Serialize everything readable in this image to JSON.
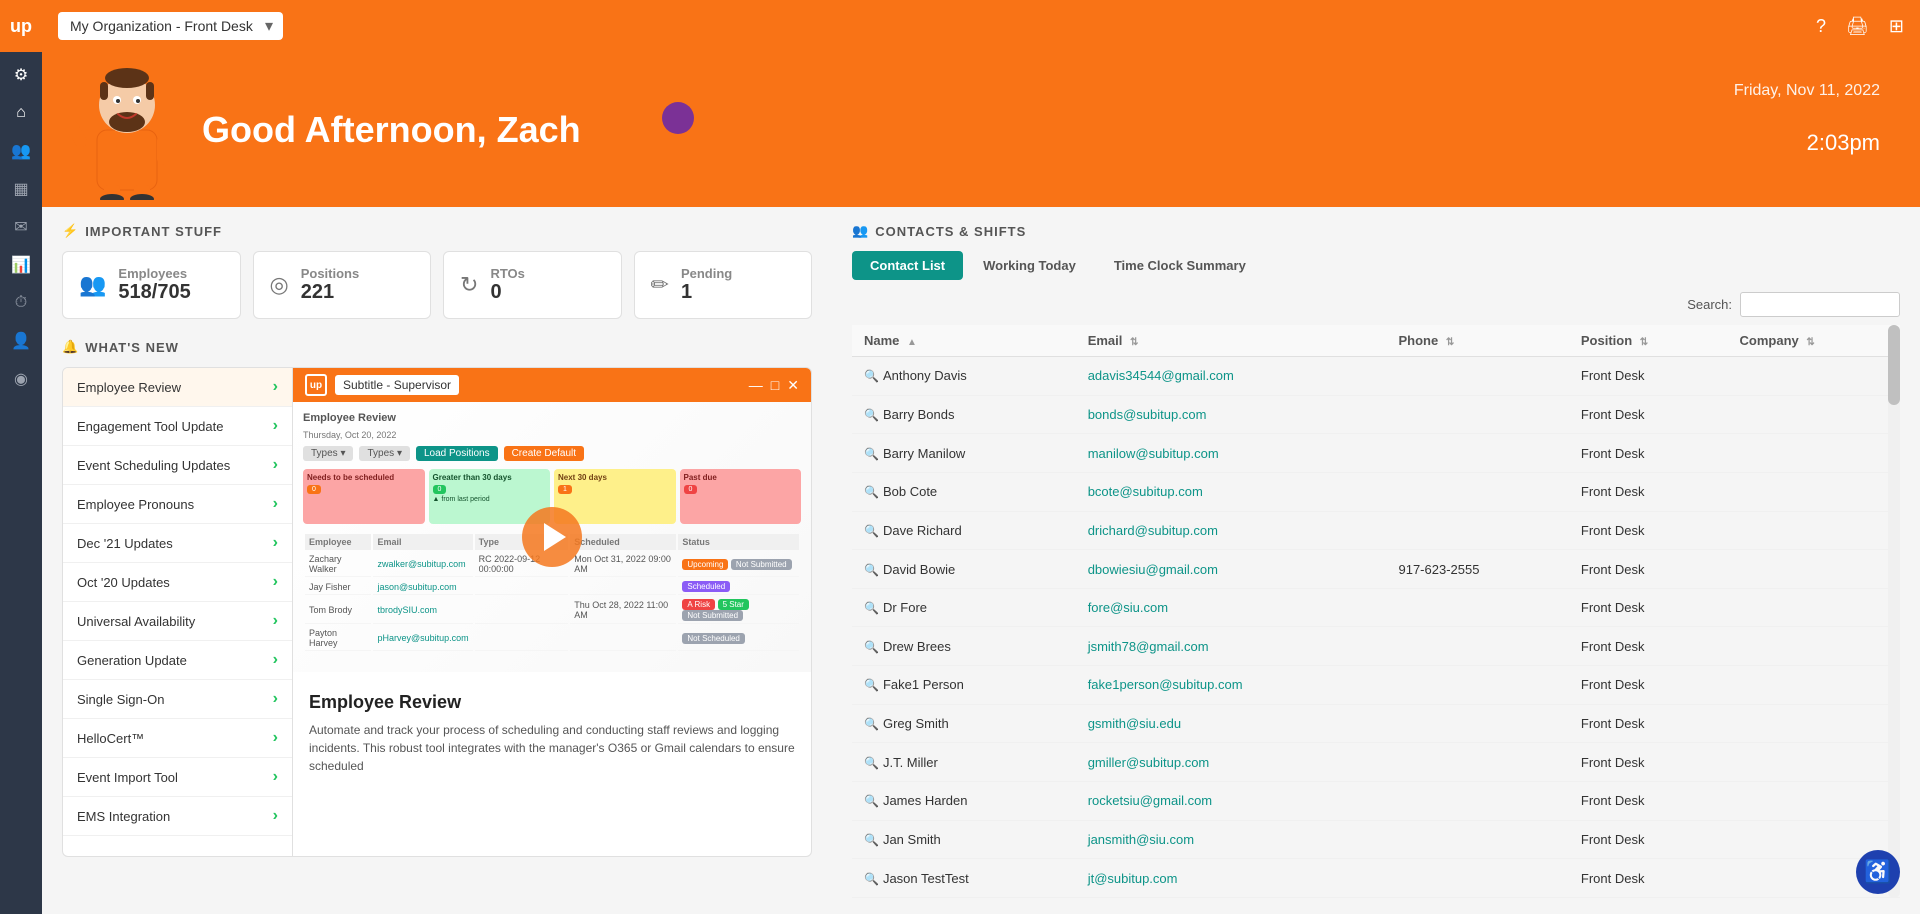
{
  "topbar": {
    "org_label": "My Organization - Front Desk",
    "help_icon": "❓",
    "print_icon": "🖨",
    "apps_icon": "⊞"
  },
  "hero": {
    "greeting": "Good Afternoon, Zach",
    "date": "Friday, Nov 11, 2022",
    "time": "2:03",
    "time_period": "pm"
  },
  "important_stuff": {
    "title": "IMPORTANT STUFF",
    "employees_label": "Employees",
    "employees_value": "518/705",
    "positions_label": "Positions",
    "positions_value": "221",
    "rtos_label": "RTOs",
    "rtos_value": "0",
    "pending_label": "Pending",
    "pending_value": "1"
  },
  "whats_new": {
    "title": "WHAT'S NEW",
    "items": [
      {
        "label": "Employee Review",
        "active": true
      },
      {
        "label": "Engagement Tool Update"
      },
      {
        "label": "Event Scheduling Updates"
      },
      {
        "label": "Employee Pronouns"
      },
      {
        "label": "Dec '21 Updates"
      },
      {
        "label": "Oct '20 Updates"
      },
      {
        "label": "Universal Availability"
      },
      {
        "label": "Generation Update"
      },
      {
        "label": "Single Sign-On"
      },
      {
        "label": "HelloCert™"
      },
      {
        "label": "Event Import Tool"
      },
      {
        "label": "EMS Integration"
      }
    ],
    "video_subtitle": "Subtitle - Supervisor",
    "featured_title": "Employee Review",
    "featured_body": "Automate and track your process of scheduling and conducting staff reviews and logging incidents. This robust tool integrates with the manager's O365 or Gmail calendars to ensure scheduled"
  },
  "contacts": {
    "section_title": "CONTACTS & SHIFTS",
    "tabs": [
      {
        "label": "Contact List",
        "active": true
      },
      {
        "label": "Working Today"
      },
      {
        "label": "Time Clock Summary"
      }
    ],
    "search_label": "Search:",
    "table": {
      "columns": [
        "Name",
        "Email",
        "Phone",
        "Position",
        "Company"
      ],
      "rows": [
        {
          "name": "Anthony Davis",
          "email": "adavis34544@gmail.com",
          "phone": "",
          "position": "Front Desk",
          "company": ""
        },
        {
          "name": "Barry Bonds",
          "email": "bonds@subitup.com",
          "phone": "",
          "position": "Front Desk",
          "company": ""
        },
        {
          "name": "Barry Manilow",
          "email": "manilow@subitup.com",
          "phone": "",
          "position": "Front Desk",
          "company": ""
        },
        {
          "name": "Bob Cote",
          "email": "bcote@subitup.com",
          "phone": "",
          "position": "Front Desk",
          "company": ""
        },
        {
          "name": "Dave Richard",
          "email": "drichard@subitup.com",
          "phone": "",
          "position": "Front Desk",
          "company": ""
        },
        {
          "name": "David Bowie",
          "email": "dbowiesiu@gmail.com",
          "phone": "917-623-2555",
          "position": "Front Desk",
          "company": ""
        },
        {
          "name": "Dr Fore",
          "email": "fore@siu.com",
          "phone": "",
          "position": "Front Desk",
          "company": ""
        },
        {
          "name": "Drew Brees",
          "email": "jsmith78@gmail.com",
          "phone": "",
          "position": "Front Desk",
          "company": ""
        },
        {
          "name": "Fake1 Person",
          "email": "fake1person@subitup.com",
          "phone": "",
          "position": "Front Desk",
          "company": ""
        },
        {
          "name": "Greg Smith",
          "email": "gsmith@siu.edu",
          "phone": "",
          "position": "Front Desk",
          "company": ""
        },
        {
          "name": "J.T. Miller",
          "email": "gmiller@subitup.com",
          "phone": "",
          "position": "Front Desk",
          "company": ""
        },
        {
          "name": "James Harden",
          "email": "rocketsiu@gmail.com",
          "phone": "",
          "position": "Front Desk",
          "company": ""
        },
        {
          "name": "Jan Smith",
          "email": "jansmith@siu.com",
          "phone": "",
          "position": "Front Desk",
          "company": ""
        },
        {
          "name": "Jason TestTest",
          "email": "jt@subitup.com",
          "phone": "",
          "position": "Front Desk",
          "company": ""
        }
      ]
    }
  },
  "sidebar": {
    "icons": [
      {
        "name": "settings-icon",
        "symbol": "⚙"
      },
      {
        "name": "home-icon",
        "symbol": "⌂",
        "active": true
      },
      {
        "name": "people-icon",
        "symbol": "👥"
      },
      {
        "name": "calendar-icon",
        "symbol": "📅"
      },
      {
        "name": "mail-icon",
        "symbol": "✉"
      },
      {
        "name": "chart-icon",
        "symbol": "📊"
      },
      {
        "name": "clock-icon",
        "symbol": "🕐"
      },
      {
        "name": "person-icon",
        "symbol": "👤"
      },
      {
        "name": "location-icon",
        "symbol": "📍"
      }
    ]
  },
  "accessibility": {
    "label": "♿"
  }
}
